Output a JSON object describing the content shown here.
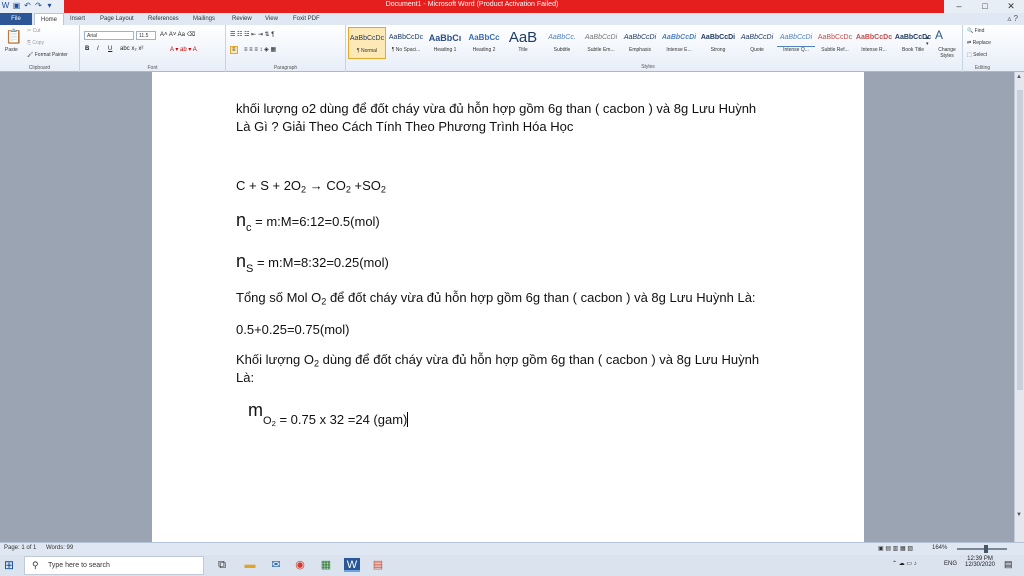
{
  "window": {
    "title": "Document1 - Microsoft Word (Product Activation Failed)"
  },
  "tabs": [
    "File",
    "Home",
    "Insert",
    "Page Layout",
    "References",
    "Mailings",
    "Review",
    "View",
    "Foxit PDF"
  ],
  "ribbon": {
    "clipboard": {
      "paste": "Paste",
      "cut": "Cut",
      "copy": "Copy",
      "format_painter": "Format Painter",
      "label": "Clipboard"
    },
    "font": {
      "name": "Arial",
      "size": "11.5",
      "label": "Font"
    },
    "paragraph": {
      "label": "Paragraph"
    },
    "styles": {
      "label": "Styles",
      "items": [
        {
          "preview": "AaBbCcDc",
          "name": "¶ Normal"
        },
        {
          "preview": "AaBbCcDc",
          "name": "¶ No Spaci..."
        },
        {
          "preview": "AaBbCı",
          "name": "Heading 1"
        },
        {
          "preview": "AaBbCc",
          "name": "Heading 2"
        },
        {
          "preview": "AaB",
          "name": "Title"
        },
        {
          "preview": "AaBbCc.",
          "name": "Subtitle"
        },
        {
          "preview": "AaBbCcDi",
          "name": "Subtle Em..."
        },
        {
          "preview": "AaBbCcDi",
          "name": "Emphasis"
        },
        {
          "preview": "AaBbCcDi",
          "name": "Intense E..."
        },
        {
          "preview": "AaBbCcDi",
          "name": "Strong"
        },
        {
          "preview": "AaBbCcDi",
          "name": "Quote"
        },
        {
          "preview": "AaBbCcDi",
          "name": "Intense Q..."
        },
        {
          "preview": "AaBbCcDc",
          "name": "Subtle Ref..."
        },
        {
          "preview": "AaBbCcDc",
          "name": "Intense R..."
        },
        {
          "preview": "AaBbCcDc",
          "name": "Book Title"
        }
      ],
      "change_styles": "Change Styles"
    },
    "editing": {
      "find": "Find",
      "replace": "Replace",
      "select": "Select",
      "label": "Editing"
    }
  },
  "document": {
    "line1": "khối lượng o2 dùng để đốt cháy vừa đủ hỗn hợp gồm 6g than ( cacbon ) và 8g Lưu Huỳnh",
    "line2": "Là Gì ? Giải Theo Cách Tính Theo Phương Trình Hóa Học",
    "eq_a": "C + S + 2O",
    "eq_sub2a": "2",
    "eq_arrow": " → CO",
    "eq_sub2b": "2",
    "eq_b": " +SO",
    "eq_sub2c": "2",
    "nc_n": "n",
    "nc_sub": "c",
    "nc_rest": "  = m:M=6:12=0.5(mol)",
    "ns_n": "n",
    "ns_sub": "S",
    "ns_rest": "  = m:M=8:32=0.25(mol)",
    "total_a": "Tổng số Mol O",
    "total_sub": "2",
    "total_b": " để đốt cháy vừa đủ hỗn hợp gồm 6g than ( cacbon ) và 8g Lưu Huỳnh Là:",
    "sum": "0.5+0.25=0.75(mol)",
    "mass_a": "Khối lượng O",
    "mass_sub": "2",
    "mass_b": "  dùng để đốt cháy vừa đủ hỗn hợp gồm 6g than ( cacbon ) và 8g Lưu Huỳnh",
    "mass_c": "Là:",
    "m_sym": "m",
    "m_sub": "O",
    "m_sub2": "2",
    "m_rest": " = 0.75 x 32 =24 (gam)"
  },
  "status": {
    "page": "Page: 1 of 1",
    "words": "Words: 99",
    "zoom": "164%"
  },
  "taskbar": {
    "search_placeholder": "Type here to search",
    "time": "12:39 PM",
    "date": "12/30/2020",
    "lang": "ENG"
  }
}
